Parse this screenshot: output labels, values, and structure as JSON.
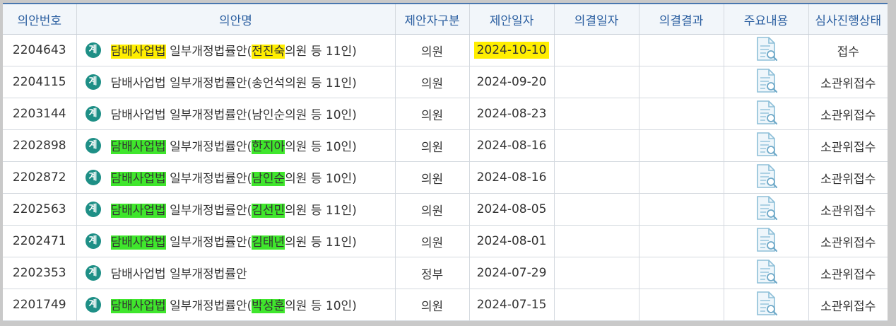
{
  "columns": {
    "bill_no": "의안번호",
    "bill_name": "의안명",
    "proposer_type": "제안자구분",
    "proposal_date": "제안일자",
    "resolution_date": "의결일자",
    "resolution_result": "의결결과",
    "summary": "주요내용",
    "review_status": "심사진행상태"
  },
  "icon_label": "계",
  "colors": {
    "header_text": "#2a5ea0",
    "header_bg": "#f2f6fa",
    "highlight_yellow": "#ffee00",
    "highlight_green": "#3fe62c",
    "badge_teal": "#1e8f86"
  },
  "rows": [
    {
      "bill_no": "2204643",
      "name": {
        "a": "담배사업법",
        "b": " 일부개정법률안",
        "c": "(",
        "d": "전진숙",
        "e": "의원 등 11인)"
      },
      "highlight": "yellow",
      "proposer_type": "의원",
      "date": "2024-10-10",
      "date_highlight": true,
      "resolution_date": "",
      "resolution_result": "",
      "summary_icon": "document-search-icon",
      "status": "접수"
    },
    {
      "bill_no": "2204115",
      "name": {
        "a": "담배사업법",
        "b": " 일부개정법률안",
        "c": "(",
        "d": "송언석",
        "e": "의원 등 11인)"
      },
      "highlight": "none",
      "proposer_type": "의원",
      "date": "2024-09-20",
      "date_highlight": false,
      "resolution_date": "",
      "resolution_result": "",
      "summary_icon": "document-search-icon",
      "status": "소관위접수"
    },
    {
      "bill_no": "2203144",
      "name": {
        "a": "담배사업법",
        "b": " 일부개정법률안",
        "c": "(",
        "d": "남인순",
        "e": "의원 등 10인)"
      },
      "highlight": "none",
      "proposer_type": "의원",
      "date": "2024-08-23",
      "date_highlight": false,
      "resolution_date": "",
      "resolution_result": "",
      "summary_icon": "document-search-icon",
      "status": "소관위접수"
    },
    {
      "bill_no": "2202898",
      "name": {
        "a": "담배사업법",
        "b": " 일부개정법률안",
        "c": "(",
        "d": "한지아",
        "e": "의원 등 10인)"
      },
      "highlight": "green",
      "proposer_type": "의원",
      "date": "2024-08-16",
      "date_highlight": false,
      "resolution_date": "",
      "resolution_result": "",
      "summary_icon": "document-search-icon",
      "status": "소관위접수"
    },
    {
      "bill_no": "2202872",
      "name": {
        "a": "담배사업법",
        "b": " 일부개정법률안",
        "c": "(",
        "d": "남인순",
        "e": "의원 등 10인)"
      },
      "highlight": "green",
      "proposer_type": "의원",
      "date": "2024-08-16",
      "date_highlight": false,
      "resolution_date": "",
      "resolution_result": "",
      "summary_icon": "document-search-icon",
      "status": "소관위접수"
    },
    {
      "bill_no": "2202563",
      "name": {
        "a": "담배사업법",
        "b": " 일부개정법률안",
        "c": "(",
        "d": "김선민",
        "e": "의원 등 11인)"
      },
      "highlight": "green",
      "proposer_type": "의원",
      "date": "2024-08-05",
      "date_highlight": false,
      "resolution_date": "",
      "resolution_result": "",
      "summary_icon": "document-search-icon",
      "status": "소관위접수"
    },
    {
      "bill_no": "2202471",
      "name": {
        "a": "담배사업법",
        "b": " 일부개정법률안",
        "c": "(",
        "d": "김태년",
        "e": "의원 등 11인)"
      },
      "highlight": "green",
      "proposer_type": "의원",
      "date": "2024-08-01",
      "date_highlight": false,
      "resolution_date": "",
      "resolution_result": "",
      "summary_icon": "document-search-icon",
      "status": "소관위접수"
    },
    {
      "bill_no": "2202353",
      "name": {
        "a": "담배사업법",
        "b": " 일부개정법률안",
        "c": "",
        "d": "",
        "e": ""
      },
      "highlight": "none",
      "proposer_type": "정부",
      "date": "2024-07-29",
      "date_highlight": false,
      "resolution_date": "",
      "resolution_result": "",
      "summary_icon": "document-search-icon",
      "status": "소관위접수"
    },
    {
      "bill_no": "2201749",
      "name": {
        "a": "담배사업법",
        "b": " 일부개정법률안",
        "c": "(",
        "d": "박성훈",
        "e": "의원 등 10인)"
      },
      "highlight": "green",
      "proposer_type": "의원",
      "date": "2024-07-15",
      "date_highlight": false,
      "resolution_date": "",
      "resolution_result": "",
      "summary_icon": "document-search-icon",
      "status": "소관위접수"
    }
  ]
}
